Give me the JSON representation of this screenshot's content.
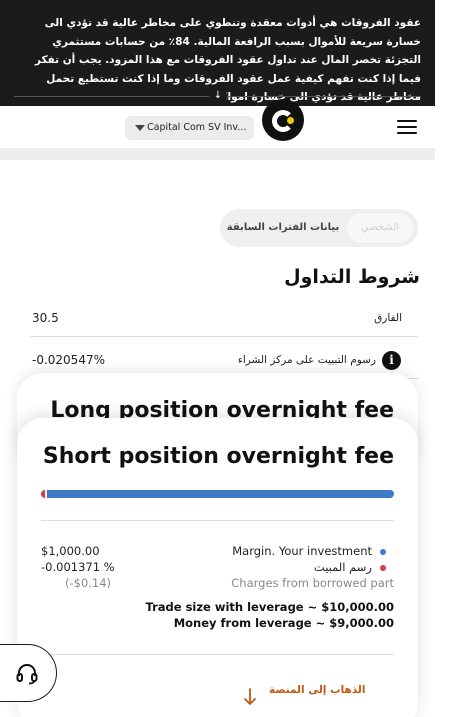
{
  "risk_warning": {
    "text": "عقود الفروقات هي أدوات معقدة وتنطوي على مخاطر عالية قد تؤدي الى خسارة سريعة للأموال بسبب الرافعة المالية. 84٪ من حسابات مستثمري التجزئة تخصر المال عند تداول عقود الفروقات مع هذا المزود. يجب أن تفكر فيما إذا كنت تفهم كيفية عمل عقود الفروقات وما إذا كنت تستطيع تحمل مخاطر عالية قد تؤدي الى خسارة اموالك.",
    "collapse_icon": "double-chevron-down-icon"
  },
  "header": {
    "entity_selector": "Capital Com SV Inv...",
    "logo_icon": "capital-com-logo",
    "menu_icon": "hamburger-menu-icon"
  },
  "tabs": {
    "current": "الشخصي",
    "previous": "بيانات الفترات السابقة"
  },
  "trading_conditions": {
    "title": "شروط التداول",
    "rows": [
      {
        "label": "الفارق",
        "value": "30.5"
      },
      {
        "label": "رسوم التبييت على مركز الشراء",
        "value": "-0.020547%",
        "icon": "info-icon"
      }
    ]
  },
  "card_long": {
    "title": "Long position overnight fee"
  },
  "card_short": {
    "title": "Short position overnight fee",
    "bar": {
      "fee_fraction": 0.012,
      "fee_color": "#d64045",
      "margin_color": "#3f79c8"
    },
    "legend": {
      "margin_label": "Margin. Your investment",
      "fee_label": "رسم المبيت",
      "borrowed_label": "Charges from borrowed part"
    },
    "amounts": {
      "margin": "$1,000.00",
      "fee_percent": "-0.001371 %",
      "fee_value": "(-$0.14)"
    },
    "trade_size": "Trade size with leverage ~ $10,000.00",
    "money_from_leverage": "Money from leverage ~ $9,000.00",
    "go_to_platform": "الذهاب إلى المنصة"
  },
  "support": {
    "icon": "headset-icon"
  }
}
